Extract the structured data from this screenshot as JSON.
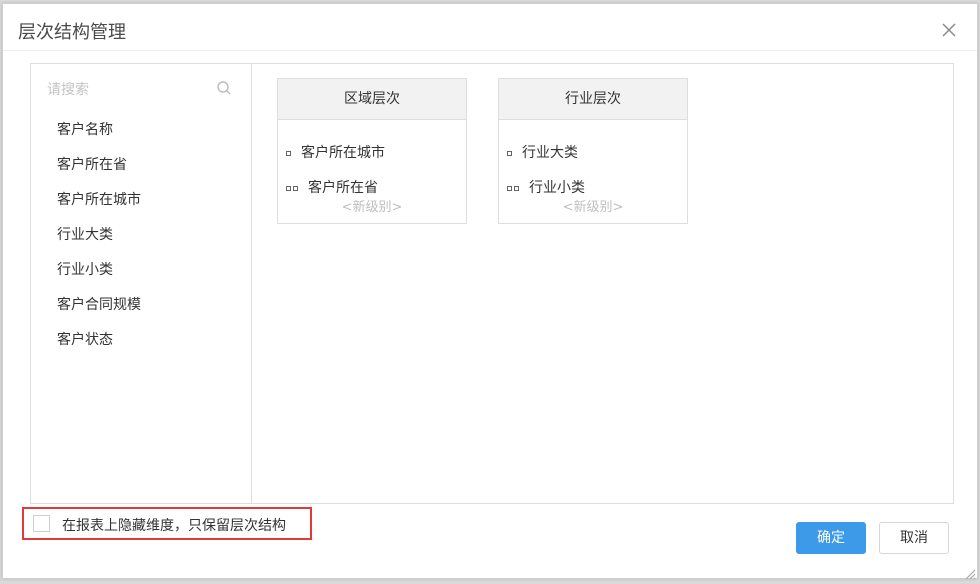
{
  "dialog": {
    "title": "层次结构管理"
  },
  "search": {
    "placeholder": "请搜索"
  },
  "fields": [
    {
      "label": "客户名称"
    },
    {
      "label": "客户所在省"
    },
    {
      "label": "客户所在城市"
    },
    {
      "label": "行业大类"
    },
    {
      "label": "行业小类"
    },
    {
      "label": "客户合同规模"
    },
    {
      "label": "客户状态"
    }
  ],
  "hierarchies": [
    {
      "name": "区域层次",
      "levels": [
        "客户所在城市",
        "客户所在省"
      ],
      "new_level": "<新级别>"
    },
    {
      "name": "行业层次",
      "levels": [
        "行业大类",
        "行业小类"
      ],
      "new_level": "<新级别>"
    }
  ],
  "option": {
    "label": "在报表上隐藏维度，只保留层次结构",
    "checked": false
  },
  "buttons": {
    "ok": "确定",
    "cancel": "取消"
  },
  "colors": {
    "primary": "#3d9ae8",
    "highlight_border": "#e23a3a"
  }
}
